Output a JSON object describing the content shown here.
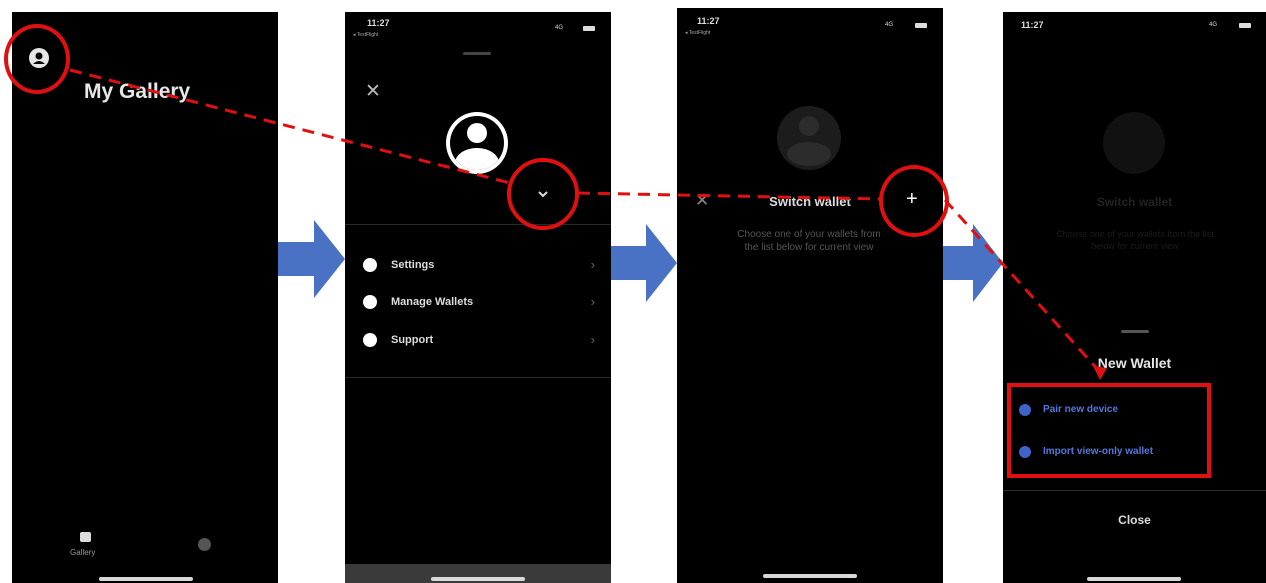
{
  "screen1": {
    "title": "My Gallery",
    "tabs": [
      {
        "label": "Gallery",
        "icon": "gallery-icon"
      },
      {
        "label": "",
        "icon": "dollar-icon"
      }
    ]
  },
  "screen2": {
    "status": {
      "time": "11:27",
      "back": "◂ TestFlight",
      "right": "4G"
    },
    "close": "✕",
    "menu": [
      {
        "label": "Settings",
        "icon": "gear-icon"
      },
      {
        "label": "Manage Wallets",
        "icon": "user-circle-icon"
      },
      {
        "label": "Support",
        "icon": "help-icon"
      }
    ],
    "chevron": "›"
  },
  "screen3": {
    "status": {
      "time": "11:27",
      "back": "◂ TestFlight",
      "right": "4G"
    },
    "header_title": "Switch wallet",
    "close": "✕",
    "add": "+",
    "description": "Choose one of your wallets from the list below for current view"
  },
  "screen4": {
    "status": {
      "time": "11:27",
      "right": "4G"
    },
    "header_title": "Switch wallet",
    "description": "Choose one of your wallets from the list below for current view",
    "sheet_title": "New Wallet",
    "options": [
      {
        "label": "Pair new device",
        "icon": "plus-circle-icon"
      },
      {
        "label": "Import view-only wallet",
        "icon": "eye-circle-icon"
      }
    ],
    "close_label": "Close"
  },
  "colors": {
    "annotation_red": "#e01010",
    "arrow_blue": "#4a72c4",
    "accent_blue": "#3f63c9"
  }
}
